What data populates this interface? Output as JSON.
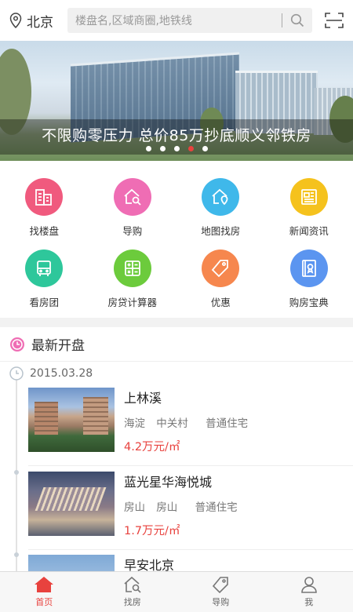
{
  "header": {
    "city": "北京",
    "search_placeholder": "楼盘名,区域商圈,地铁线"
  },
  "banner": {
    "caption": "不限购零压力  总价85万抄底顺义邻铁房",
    "slide_count": 5,
    "active_slide": 4
  },
  "grid": [
    {
      "label": "找楼盘",
      "icon": "building-icon",
      "color": "#f05a7e"
    },
    {
      "label": "导购",
      "icon": "home-search-icon",
      "color": "#ef6db4"
    },
    {
      "label": "地图找房",
      "icon": "map-home-icon",
      "color": "#3fb8ea"
    },
    {
      "label": "新闻资讯",
      "icon": "news-icon",
      "color": "#f5c21d"
    },
    {
      "label": "看房团",
      "icon": "bus-icon",
      "color": "#2ec79b"
    },
    {
      "label": "房贷计算器",
      "icon": "calculator-icon",
      "color": "#6ccb3c"
    },
    {
      "label": "优惠",
      "icon": "tag-icon",
      "color": "#f6874e"
    },
    {
      "label": "购房宝典",
      "icon": "book-icon",
      "color": "#5b95f0"
    }
  ],
  "latest": {
    "title": "最新开盘",
    "date": "2015.03.28",
    "items": [
      {
        "name": "上林溪",
        "district": "海淀",
        "area": "中关村",
        "type": "普通住宅",
        "price": "4.2万元/㎡"
      },
      {
        "name": "蓝光星华海悦城",
        "district": "房山",
        "area": "房山",
        "type": "普通住宅",
        "price": "1.7万元/㎡"
      },
      {
        "name": "早安北京",
        "district": "",
        "area": "",
        "type": "",
        "price": ""
      }
    ]
  },
  "tabs": [
    {
      "label": "首页",
      "icon": "home-icon",
      "active": true
    },
    {
      "label": "找房",
      "icon": "find-house-icon",
      "active": false
    },
    {
      "label": "导购",
      "icon": "tag-icon",
      "active": false
    },
    {
      "label": "我",
      "icon": "user-icon",
      "active": false
    }
  ],
  "colors": {
    "accent": "#e8423e",
    "section_icon": "#ef6db4"
  }
}
